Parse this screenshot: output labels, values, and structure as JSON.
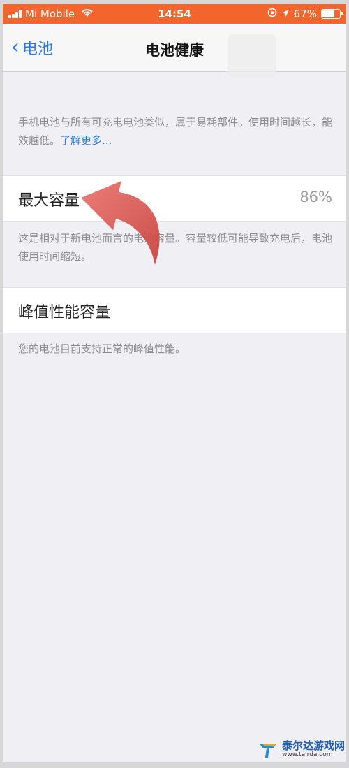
{
  "status_bar": {
    "carrier": "Mi Mobile",
    "time": "14:54",
    "battery_percent": "67%",
    "battery_level": 0.67,
    "color": "#f2652d"
  },
  "nav": {
    "back_label": "电池",
    "title": "电池健康"
  },
  "intro": {
    "text": "手机电池与所有可充电电池类似，属于易耗部件。使用时间越长，能效越低。",
    "link": "了解更多..."
  },
  "max_capacity": {
    "label": "最大容量",
    "value": "86%",
    "description": "这是相对于新电池而言的电池容量。容量较低可能导致充电后，电池使用时间缩短。"
  },
  "peak_performance": {
    "label": "峰值性能容量",
    "description": "您的电池目前支持正常的峰值性能。"
  },
  "watermark": {
    "name": "泰尔达游戏网",
    "url": "www.tairda.com"
  },
  "colors": {
    "accent": "#2b7ae8",
    "arrow": "#d9534f"
  }
}
